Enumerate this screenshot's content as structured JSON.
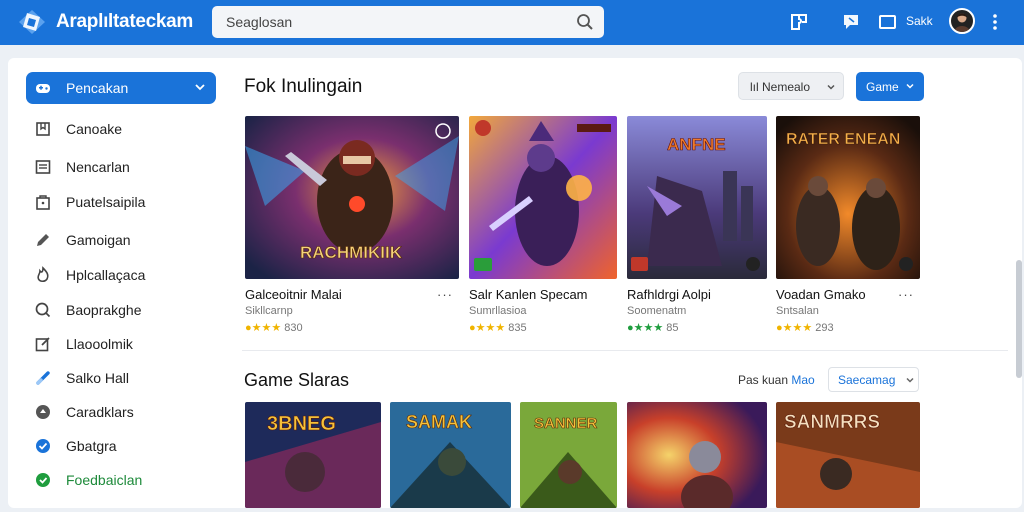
{
  "app": {
    "title": "Araplıltateckam"
  },
  "search": {
    "placeholder": "Seaglosan"
  },
  "topbar": {
    "account_label": "Sakk"
  },
  "sidebar": {
    "items": [
      {
        "label": "Pencakan",
        "icon": "gamepad-icon",
        "active": true
      },
      {
        "label": "Canoake",
        "icon": "bookmark-icon"
      },
      {
        "label": "Nencarlan",
        "icon": "list-icon"
      },
      {
        "label": "Puatelsaipila",
        "icon": "bag-icon"
      },
      {
        "label": "Gamoigan",
        "icon": "pen-icon"
      },
      {
        "label": "Hplcallaçaca",
        "icon": "flame-icon"
      },
      {
        "label": "Baoprakghe",
        "icon": "search-icon"
      },
      {
        "label": "Llaooolmik",
        "icon": "edit-icon"
      },
      {
        "label": "Salko Hall",
        "icon": "link-icon"
      },
      {
        "label": "Caradklars",
        "icon": "settings-icon"
      },
      {
        "label": "Gbatgra",
        "icon": "check-icon"
      },
      {
        "label": "Foedbaiclan",
        "icon": "help-icon"
      }
    ]
  },
  "section1": {
    "title": "Fok Inulingain",
    "filter_label": "lıl Nemealo",
    "game_label": "Game",
    "cards": [
      {
        "title": "Galceoitnir Malai",
        "sub": "Sikllcarnp",
        "rating": "830",
        "banner": "RACHMIKIIK",
        "badge": "green"
      },
      {
        "title": "Salr Kanlen Specam",
        "sub": "Sumrllasioa",
        "rating": "835",
        "banner": "",
        "badge": "gold"
      },
      {
        "title": "Rafhldrgi Aolpi",
        "sub": "Soomenatm",
        "rating": "85",
        "banner": "ANFNE",
        "badge": "green"
      },
      {
        "title": "Voadan Gmako",
        "sub": "Sntsalan",
        "rating": "293",
        "banner": "RATER ENEAN",
        "badge": "gold"
      }
    ]
  },
  "section2": {
    "title": "Game Slaras",
    "link_label": "Pas kuan",
    "link_highlight": "Mao",
    "select_label": "Saecamag",
    "cards": [
      {
        "banner": "3BNEG"
      },
      {
        "banner": "SAMAK"
      },
      {
        "banner": "SANNER"
      },
      {
        "banner": ""
      },
      {
        "banner": "SANMRRS"
      }
    ]
  },
  "colors": {
    "accent": "#1a73d9",
    "star": "#f0b400",
    "green": "#1f9d3e"
  }
}
